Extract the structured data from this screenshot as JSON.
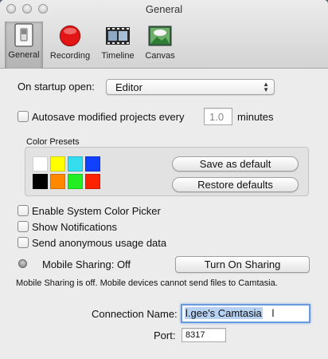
{
  "window": {
    "title": "General"
  },
  "toolbar": {
    "items": [
      {
        "label": "General",
        "icon": "switch-icon"
      },
      {
        "label": "Recording",
        "icon": "record-icon"
      },
      {
        "label": "Timeline",
        "icon": "film-strip-icon"
      },
      {
        "label": "Canvas",
        "icon": "canvas-landscape-icon"
      }
    ]
  },
  "startup": {
    "label": "On startup open:",
    "value": "Editor"
  },
  "autosave": {
    "label": "Autosave modified projects every",
    "value": "1.0",
    "unit": "minutes",
    "checked": false
  },
  "color_presets": {
    "title": "Color Presets",
    "swatches_top": [
      "#ffffff",
      "#ffff00",
      "#33ddee",
      "#1140ff"
    ],
    "swatches_bottom": [
      "#000000",
      "#ff8800",
      "#22ee22",
      "#ff2200"
    ],
    "save_label": "Save as default",
    "restore_label": "Restore defaults"
  },
  "options": [
    {
      "label": "Enable System Color Picker",
      "checked": false
    },
    {
      "label": "Show Notifications",
      "checked": false
    },
    {
      "label": "Send anonymous usage data",
      "checked": false
    }
  ],
  "mobile_sharing": {
    "status_label": "Mobile Sharing: Off",
    "button_label": "Turn On Sharing",
    "note": "Mobile Sharing is off. Mobile devices cannot send files to Camtasia."
  },
  "connection": {
    "label": "Connection Name:",
    "value": "l.gee's Camtasia"
  },
  "port": {
    "label": "Port:",
    "value": "8317"
  }
}
